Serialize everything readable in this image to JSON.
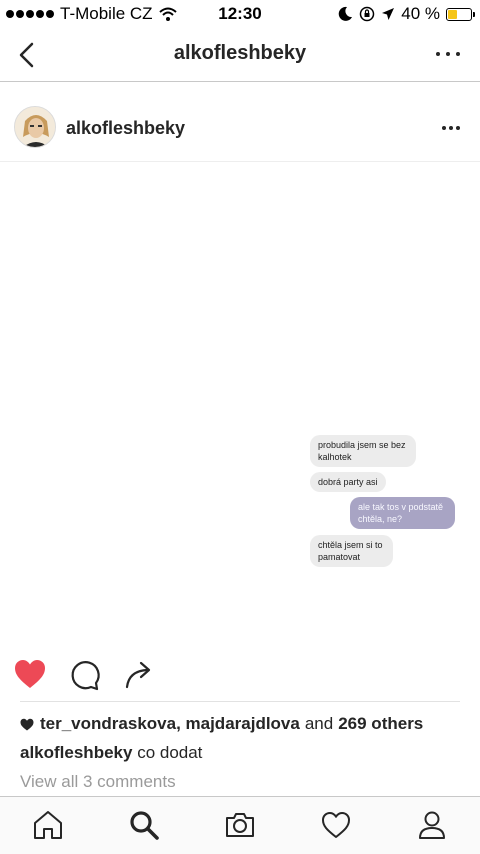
{
  "status_bar": {
    "carrier": "T-Mobile CZ",
    "time": "12:30",
    "battery_percent_label": "40 %",
    "battery_level": 0.4,
    "signal_bars": 5
  },
  "nav": {
    "title": "alkofleshbeky"
  },
  "post": {
    "username": "alkofleshbeky",
    "messages": [
      {
        "direction": "in",
        "text": "probudila jsem se bez kalhotek"
      },
      {
        "direction": "in",
        "text": "dobrá party asi"
      },
      {
        "direction": "out",
        "text": "ale tak tos v podstatě chtěla, ne?"
      },
      {
        "direction": "in",
        "text": "chtěla jsem si to pamatovat"
      }
    ],
    "liked": true,
    "likes": {
      "names": "ter_vondraskova, majdarajdlova",
      "and_text": "and",
      "others": "269 others"
    },
    "caption": {
      "user": "alkofleshbeky",
      "text": "co dodat"
    },
    "view_comments": "View all 3 comments"
  },
  "colors": {
    "like_red": "#ed4956",
    "text": "#262626",
    "muted": "#9a9a9a",
    "outgoing_bubble": "#a8a4c4",
    "incoming_bubble": "#ececec",
    "battery": "#f5c518"
  },
  "icons": [
    "back-icon",
    "more-icon",
    "heart-icon",
    "comment-icon",
    "share-icon",
    "home-icon",
    "search-icon",
    "camera-icon",
    "activity-icon",
    "profile-icon"
  ]
}
